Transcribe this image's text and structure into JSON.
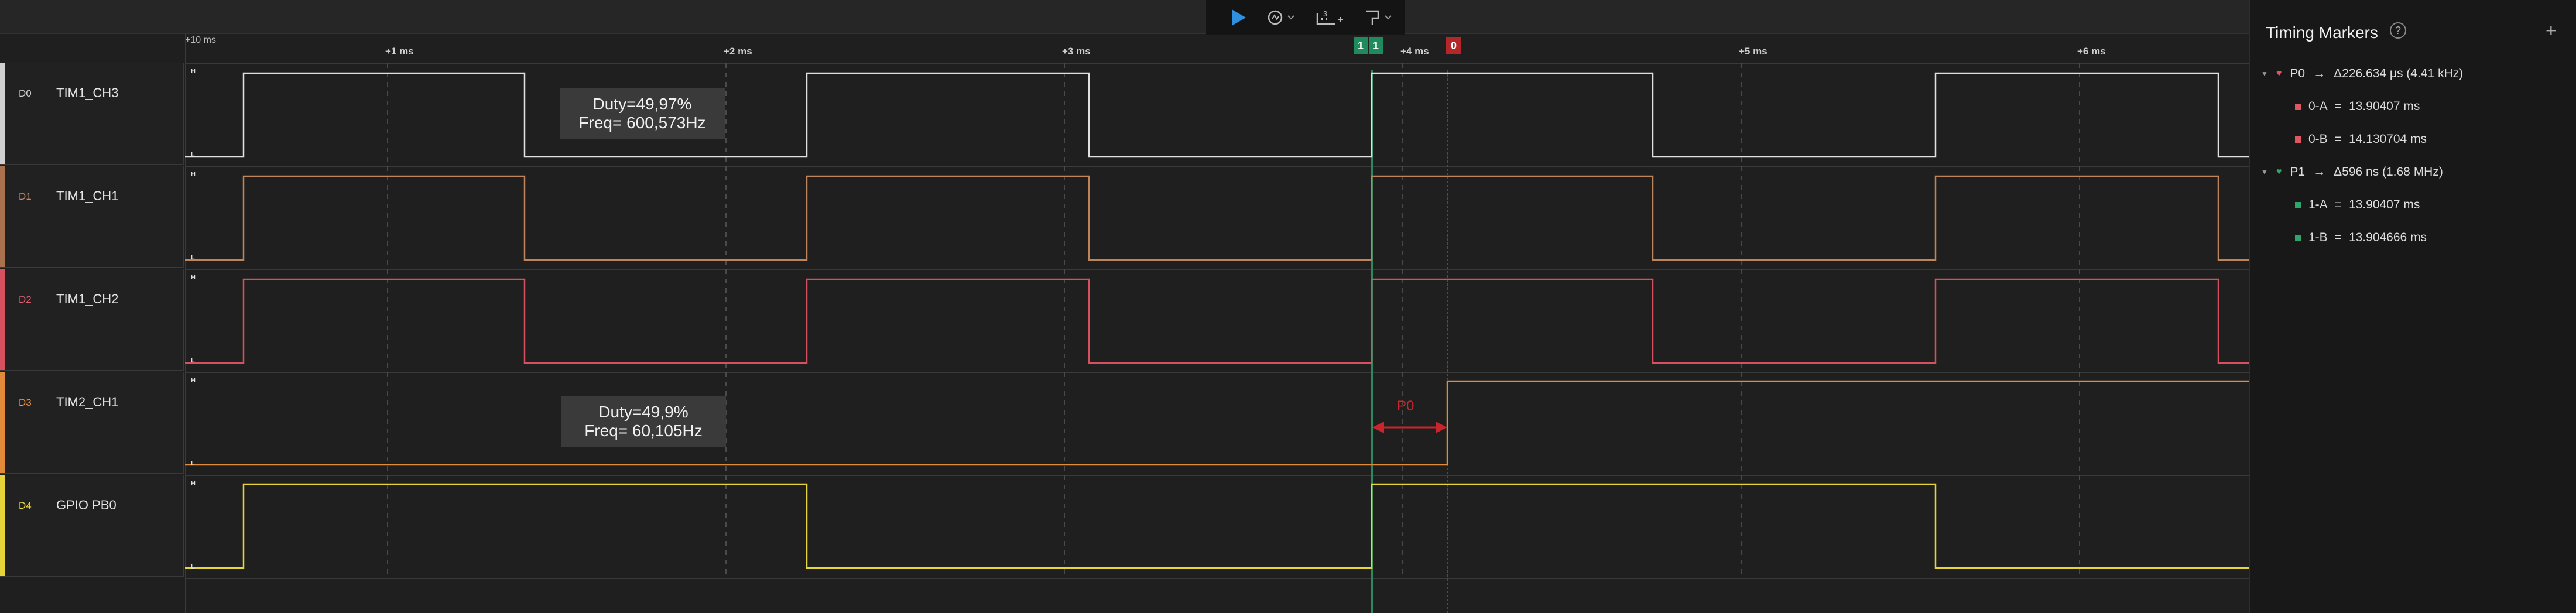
{
  "toolbar": {
    "play": "play-icon",
    "trigger": "trigger-icon",
    "measure": "measure-icon",
    "marker": "marker-icon"
  },
  "timeline": {
    "origin_label": "+10 ms",
    "ticks": [
      "+1 ms",
      "+2 ms",
      "+3 ms",
      "+4 ms",
      "+5 ms",
      "+6 ms"
    ]
  },
  "markers": {
    "flags": [
      {
        "text": "1",
        "color": "#1f8a5b"
      },
      {
        "text": "1",
        "color": "#1f8a5b"
      },
      {
        "text": "0",
        "color": "#b3262a"
      }
    ],
    "measure_label": "P0"
  },
  "channels": [
    {
      "id": "D0",
      "name": "TIM1_CH3",
      "color": "#e0e0e0",
      "id_color": "#cfcfcf"
    },
    {
      "id": "D1",
      "name": "TIM1_CH1",
      "color": "#a9714e",
      "id_color": "#c98a62"
    },
    {
      "id": "D2",
      "name": "TIM1_CH2",
      "color": "#d6505f",
      "id_color": "#e36070"
    },
    {
      "id": "D3",
      "name": "TIM2_CH1",
      "color": "#e08a3a",
      "id_color": "#f09a45"
    },
    {
      "id": "D4",
      "name": "GPIO PB0",
      "color": "#e6d53a",
      "id_color": "#f0df40"
    }
  ],
  "levels": {
    "high": "H",
    "low": "L"
  },
  "annotations": [
    {
      "line1": "Duty=49,97%",
      "line2": "Freq= 600,573Hz"
    },
    {
      "line1": "Duty=49,9%",
      "line2": "Freq= 60,105Hz"
    }
  ],
  "panel": {
    "title": "Timing Markers",
    "help": "?",
    "add": "+",
    "pairs": [
      {
        "name": "P0",
        "arrow": "→",
        "delta": "Δ226.634 μs (4.41 kHz)",
        "color": "#e05562",
        "markers": [
          {
            "name": "0-A",
            "eq": "=",
            "value": "13.90407 ms"
          },
          {
            "name": "0-B",
            "eq": "=",
            "value": "14.130704 ms"
          }
        ]
      },
      {
        "name": "P1",
        "arrow": "→",
        "delta": "Δ596 ns (1.68 MHz)",
        "color": "#2fa56d",
        "markers": [
          {
            "name": "1-A",
            "eq": "=",
            "value": "13.90407 ms"
          },
          {
            "name": "1-B",
            "eq": "=",
            "value": "13.904666 ms"
          }
        ]
      }
    ]
  }
}
